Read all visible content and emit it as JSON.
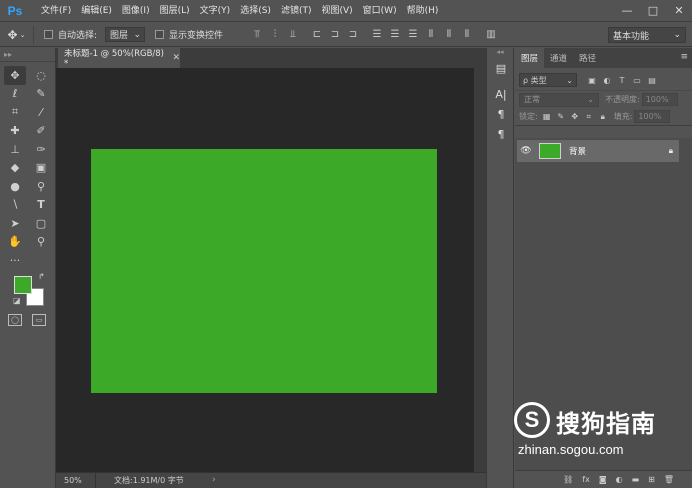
{
  "app": {
    "logo": "Ps",
    "menu": [
      "文件(F)",
      "编辑(E)",
      "图像(I)",
      "图层(L)",
      "文字(Y)",
      "选择(S)",
      "滤镜(T)",
      "视图(V)",
      "窗口(W)",
      "帮助(H)"
    ],
    "window_controls": [
      "—",
      "□",
      "✕"
    ]
  },
  "options_bar": {
    "tool_icon": "move-icon",
    "auto_select_label": "自动选择:",
    "auto_select_value": "图层",
    "show_transform_label": "显示变换控件",
    "workspace": "基本功能"
  },
  "document": {
    "tab_title": "未标题-1 @ 50%(RGB/8) *",
    "canvas_color": "#3ca928",
    "zoom": "50%",
    "doc_info": "文档:1.91M/0 字节"
  },
  "colors": {
    "foreground": "#3ca928",
    "background": "#ffffff"
  },
  "layers_panel": {
    "tabs": [
      "图层",
      "通道",
      "路径"
    ],
    "filter_label": "ρ 类型",
    "blend_mode": "正常",
    "opacity_label": "不透明度:",
    "opacity_value": "100%",
    "lock_label": "锁定:",
    "fill_label": "填充:",
    "fill_value": "100%",
    "layers": [
      {
        "name": "背景",
        "thumb_color": "#3ca928",
        "locked": true
      }
    ]
  },
  "watermark": {
    "logo_letter": "S",
    "text": "搜狗指南",
    "url": "zhinan.sogou.com"
  }
}
